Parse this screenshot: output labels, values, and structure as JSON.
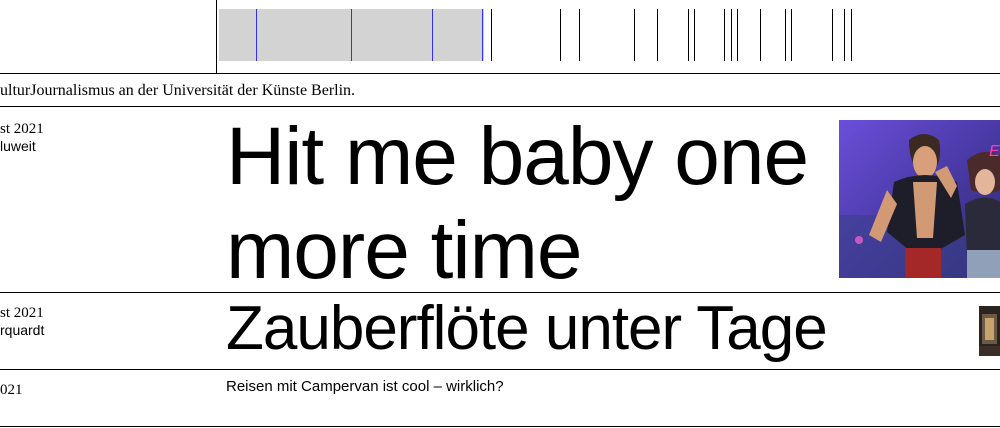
{
  "site": {
    "tagline": "ulturJournalismus an der Universität der Künste Berlin."
  },
  "articles": [
    {
      "date": "st 2021",
      "author": "luweit",
      "title_line1": "Hit me baby one",
      "title_line2": "more time",
      "image_icon": "video-game-characters-illustration"
    },
    {
      "date": "st 2021",
      "author": "rquardt",
      "title": "Zauberflöte unter Tage",
      "image_icon": "underground-stage-photo"
    },
    {
      "date": "021",
      "title": "Reisen mit Campervan ist cool – wirklich?"
    }
  ],
  "colors": {
    "progress_fill": "#d3d3d3",
    "progress_lines": "#3030ff",
    "text": "#000000",
    "background": "#ffffff"
  }
}
